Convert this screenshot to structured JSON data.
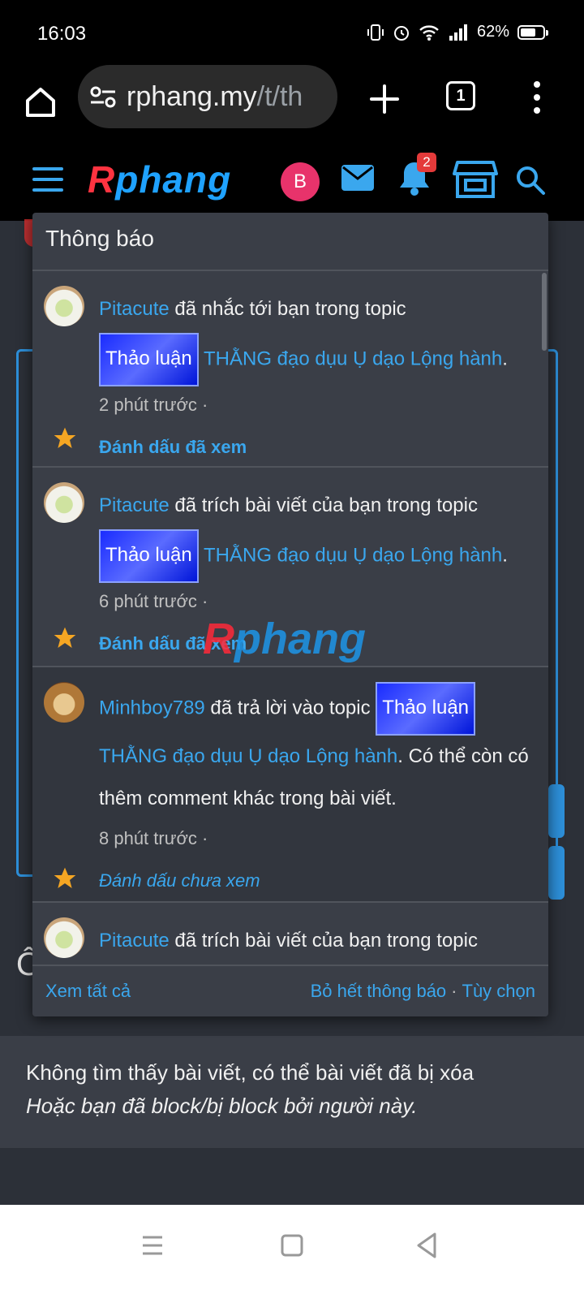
{
  "status": {
    "time": "16:03",
    "battery": "62%"
  },
  "browser": {
    "url_main": "rphang.my",
    "url_rest": "/t/th",
    "tab_count": "1"
  },
  "site": {
    "logo_first": "R",
    "logo_rest": "phang",
    "avatar_letter": "B",
    "notif_badge": "2"
  },
  "popup": {
    "title": "Thông báo",
    "watermark": "Rphang",
    "footer": {
      "see_all": "Xem tất cả",
      "dismiss_all": "Bỏ hết thông báo",
      "sep": "·",
      "options": "Tùy chọn"
    },
    "items": [
      {
        "user": "Pitacute",
        "action": " đã nhắc tới bạn trong topic",
        "tag": "Thảo luận",
        "topic": "THẰNG đạo dụu Ụ dạo Lộng hành",
        "after": ".",
        "time": "2 phút trước ·",
        "mark": "Đánh dấu đã xem"
      },
      {
        "user": "Pitacute",
        "action": " đã trích bài viết của bạn trong topic",
        "tag": "Thảo luận",
        "topic": "THẰNG đạo dụu Ụ dạo Lộng hành",
        "after": ".",
        "time": "6 phút trước ·",
        "mark": "Đánh dấu đã xem"
      },
      {
        "user": "Minhboy789",
        "action": " đã trả lời vào topic ",
        "tag": "Thảo luận",
        "topic": "THẰNG đạo dụu Ụ dạo Lộng hành",
        "after": ". Có thể còn có thêm comment khác trong bài viết.",
        "time": "8 phút trước ·",
        "mark": "Đánh dấu chưa xem"
      },
      {
        "user": "Pitacute",
        "action": " đã trích bài viết của bạn trong topic"
      }
    ]
  },
  "background": {
    "partial_char": "Ô",
    "notfound_line1": "Không tìm thấy bài viết, có thể bài viết đã bị xóa",
    "notfound_line2": "Hoặc bạn đã block/bị block bởi người này."
  }
}
